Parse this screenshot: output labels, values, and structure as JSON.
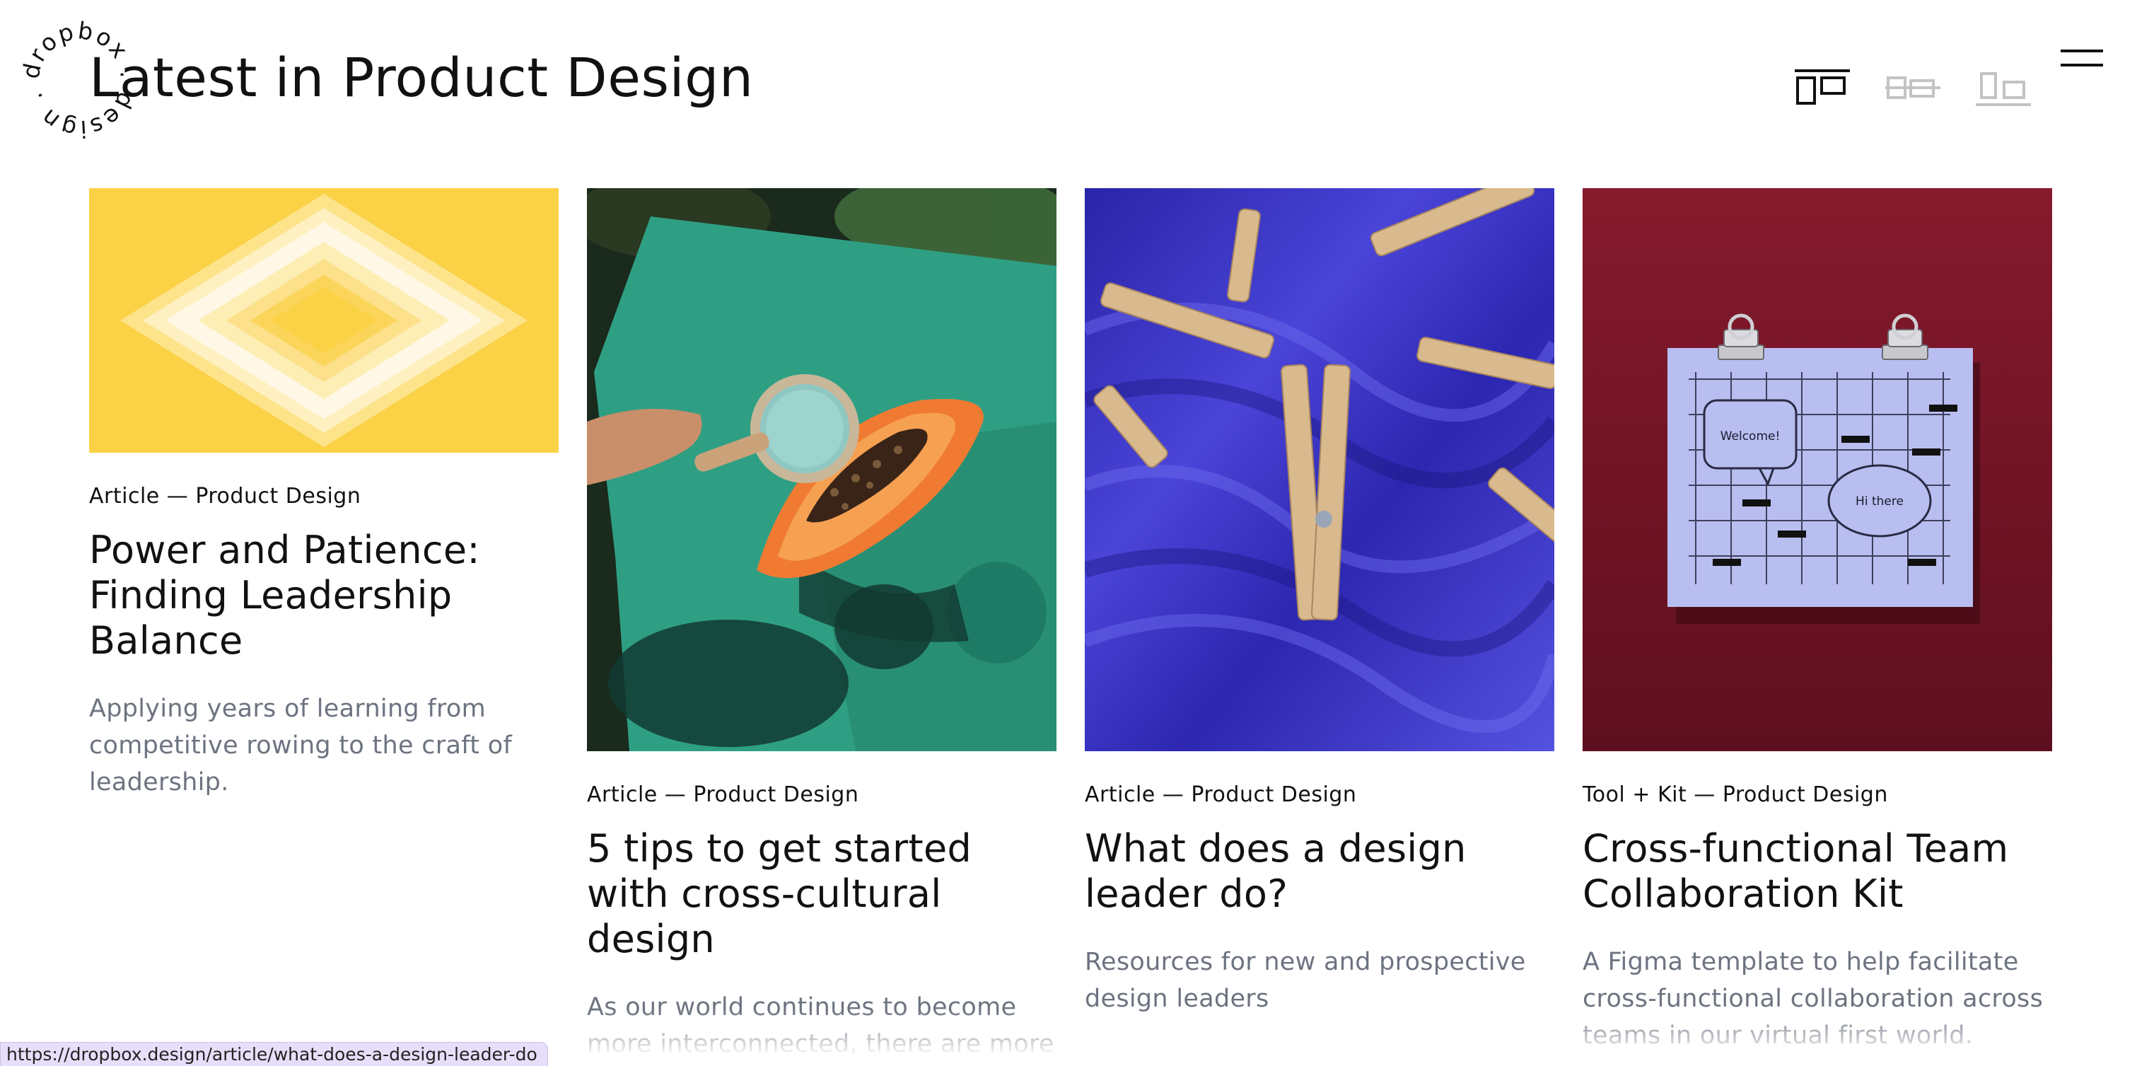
{
  "logo": {
    "text": "dropbox . design . ",
    "label": "dropbox design"
  },
  "page": {
    "title": "Latest in Product Design"
  },
  "view_toggles": [
    {
      "name": "grid-large",
      "active": true
    },
    {
      "name": "grid-list",
      "active": false
    },
    {
      "name": "grid-compact",
      "active": false
    }
  ],
  "cards": [
    {
      "meta": "Article — Product Design",
      "title": "Power and Patience: Finding Leadership Balance",
      "description": "Applying years of learning from competitive rowing to the craft of leadership.",
      "image": "yellow-pixel-diamond"
    },
    {
      "meta": "Article — Product Design",
      "title": "5 tips to get started with cross-cultural design",
      "description": "As our world continues to become more interconnected, there are more opportunities than ever for",
      "image": "magnifier-papaya-photo"
    },
    {
      "meta": "Article — Product Design",
      "title": "What does a design leader do?",
      "description": "Resources for new and prospective design leaders",
      "image": "clothespins-blue-satin-photo"
    },
    {
      "meta": "Tool + Kit — Product Design",
      "title": "Cross-functional Team Collaboration Kit",
      "description": "A Figma template to help facilitate cross-functional collaboration across teams in our virtual first world.",
      "image": "clipboard-whiteboard-photo",
      "image_text": {
        "bubble1": "Welcome!",
        "bubble2": "Hi there"
      }
    }
  ],
  "status_bar": {
    "url": "https://dropbox.design/article/what-does-a-design-leader-do"
  },
  "colors": {
    "yellow": "#fbd146",
    "teal": "#2f9f84",
    "blue_satin": "#3b34c4",
    "maroon": "#7a1526",
    "lavender": "#b8bef0",
    "desc_gray": "#6d7380"
  }
}
